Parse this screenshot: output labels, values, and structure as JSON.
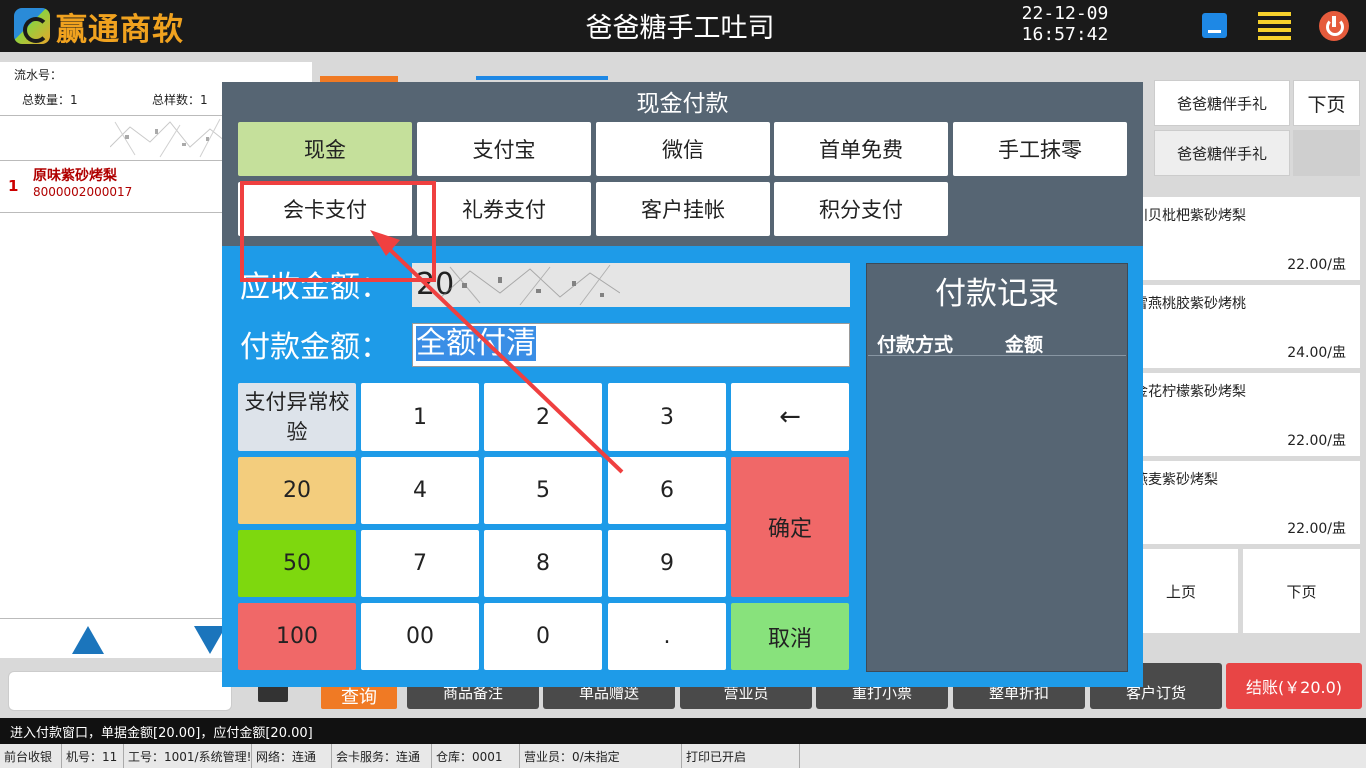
{
  "header": {
    "logo_text": "赢通商软",
    "store_title": "爸爸糖手工吐司",
    "date": "22-12-09",
    "time": "16:57:42"
  },
  "order": {
    "serial_label": "流水号：",
    "total_qty_label": "总数量：1",
    "total_kinds_label": "总样数：1",
    "items": [
      {
        "index": "1",
        "name": "原味紫砂烤梨",
        "code": "8000002000017"
      }
    ]
  },
  "categories": {
    "row1": [
      "爸爸糖伴手礼",
      "下页"
    ],
    "row2": [
      "爸爸糖伴手礼"
    ]
  },
  "products": [
    {
      "name": "川贝枇杷紫砂烤梨",
      "price": "22.00/盅"
    },
    {
      "name": "雪燕桃胶紫砂烤桃",
      "price": "24.00/盅"
    },
    {
      "name": "金花柠檬紫砂烤梨",
      "price": "22.00/盅"
    },
    {
      "name": "燕麦紫砂烤梨",
      "price": "22.00/盅"
    }
  ],
  "paging": {
    "prev": "上页",
    "next": "下页"
  },
  "actions": {
    "query": "查询",
    "goods_note": "商品备注",
    "single_gift": "单品赠送",
    "salesperson": "营业员",
    "reprint": "重打小票",
    "whole_discount": "整单折扣",
    "customer_order": "客户订货",
    "checkout": "结账(￥20.0)"
  },
  "message": "进入付款窗口，单据金额[20.00]，应付金额[20.00]",
  "status_bar": [
    "前台收银",
    "机号：11",
    "工号：1001/系统管理!",
    "网络：连通",
    "会卡服务：连通",
    "仓库：0001",
    "营业员：0/未指定",
    "打印已开启"
  ],
  "dialog": {
    "title": "现金付款",
    "methods_row1": [
      "现金",
      "支付宝",
      "微信",
      "首单免费",
      "手工抹零"
    ],
    "methods_row2": [
      "会卡支付",
      "礼券支付",
      "客户挂帐",
      "积分支付"
    ],
    "active_method": "现金",
    "due_label": "应收金额：",
    "due_value": "20",
    "paid_label": "付款金额：",
    "paid_value": "全额付清",
    "check_label": "支付异常校验",
    "keys": {
      "k1": "1",
      "k2": "2",
      "k3": "3",
      "back": "←",
      "k4": "4",
      "k5": "5",
      "k6": "6",
      "k7": "7",
      "k8": "8",
      "k9": "9",
      "k00": "00",
      "k0": "0",
      "dot": ".",
      "q20": "20",
      "q50": "50",
      "q100": "100",
      "confirm": "确定",
      "cancel": "取消"
    },
    "records_title": "付款记录",
    "records_col_method": "付款方式",
    "records_col_amount": "金额"
  },
  "colors": {
    "dialog_bg": "#566573",
    "keypad_bg": "#1e9be8",
    "active_method": "#c5e09b",
    "annotation": "#ef4040",
    "confirm": "#f06868",
    "cancel": "#88e27c"
  }
}
